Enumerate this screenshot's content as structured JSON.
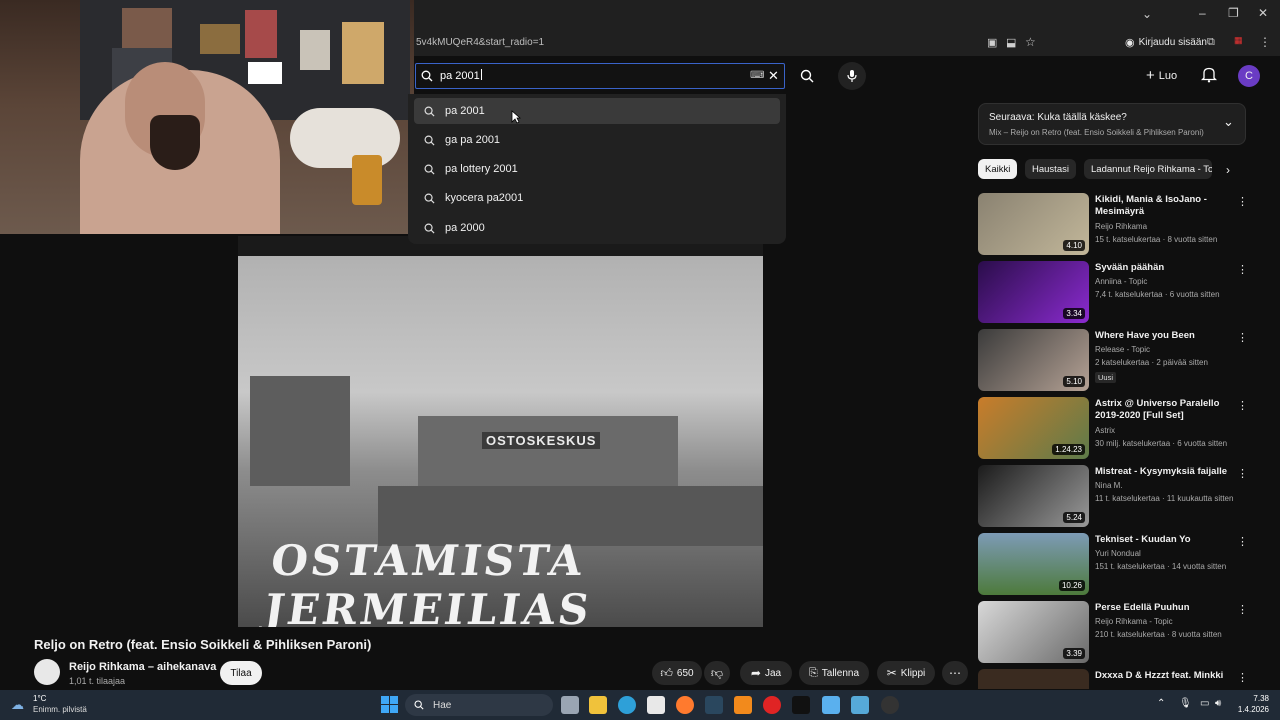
{
  "browser": {
    "url": "5v4kMUQeR4&start_radio=1",
    "login_label": "Kirjaudu sisään"
  },
  "search": {
    "query": "pa 2001",
    "suggestions": [
      "pa 2001",
      "ga pa 2001",
      "pa lottery 2001",
      "kyocera pa2001",
      "pa 2000"
    ]
  },
  "header": {
    "create_label": "Luo",
    "avatar_letter": "C"
  },
  "video": {
    "sign_text": "OSTOSKESKUS",
    "graffiti_text": "OSTAMISTA JERMEILIAS",
    "title": "Reljo on Retro (feat. Ensio Soikkeli & Pihliksen Paroni)",
    "channel": "Reijo Rihkama – aihekanava",
    "subscribers": "1,01 t. tilaajaa",
    "subscribe_label": "Tilaa",
    "likes": "650",
    "share_label": "Jaa",
    "save_label": "Tallenna",
    "clip_label": "Klippi"
  },
  "sidebar": {
    "next_label": "Seuraava: Kuka täällä käskee?",
    "next_sub": "Mix – Reijo on Retro (feat. Ensio Soikkeli & Pihliksen Paroni)",
    "chips": [
      "Kaikki",
      "Haustasi",
      "Ladannut Reijo Rihkama - To"
    ],
    "recs": [
      {
        "title": "Kikidi, Mania & IsoJano - Mesimäyrä",
        "channel": "Reijo Rihkama",
        "meta": "15 t. katselukertaa · 8 vuotta sitten",
        "duration": "4.10",
        "badge": ""
      },
      {
        "title": "Syvään päähän",
        "channel": "Anniina - Topic",
        "meta": "7,4 t. katselukertaa · 6 vuotta sitten",
        "duration": "3.34",
        "badge": ""
      },
      {
        "title": "Where Have you Been",
        "channel": "Release - Topic",
        "meta": "2 katselukertaa · 2 päivää sitten",
        "duration": "5.10",
        "badge": "Uusi"
      },
      {
        "title": "Astrix @ Universo Paralello 2019-2020 [Full Set]",
        "channel": "Astrix",
        "meta": "30 milj. katselukertaa · 6 vuotta sitten",
        "duration": "1.24.23",
        "badge": ""
      },
      {
        "title": "Mistreat - Kysymyksiä faijalle",
        "channel": "Nina M.",
        "meta": "11 t. katselukertaa · 11 kuukautta sitten",
        "duration": "5.24",
        "badge": ""
      },
      {
        "title": "Tekniset - Kuudan Yo",
        "channel": "Yuri Nondual",
        "meta": "151 t. katselukertaa · 14 vuotta sitten",
        "duration": "10.26",
        "badge": ""
      },
      {
        "title": "Perse Edellä Puuhun",
        "channel": "Reijo Rihkama - Topic",
        "meta": "210 t. katselukertaa · 8 vuotta sitten",
        "duration": "3.39",
        "badge": ""
      },
      {
        "title": "Dxxxa D & Hzzzt feat. Minkki",
        "channel": "",
        "meta": "",
        "duration": "",
        "badge": ""
      }
    ]
  },
  "taskbar": {
    "temp": "1°C",
    "weather": "Enimm. pilvistä",
    "search_label": "Hae",
    "time": "7.38",
    "date": "1.4.2026"
  },
  "colors": {
    "accent": "#3a63c9",
    "avatar": "#6a3cc4",
    "background": "#0f0f0f"
  }
}
